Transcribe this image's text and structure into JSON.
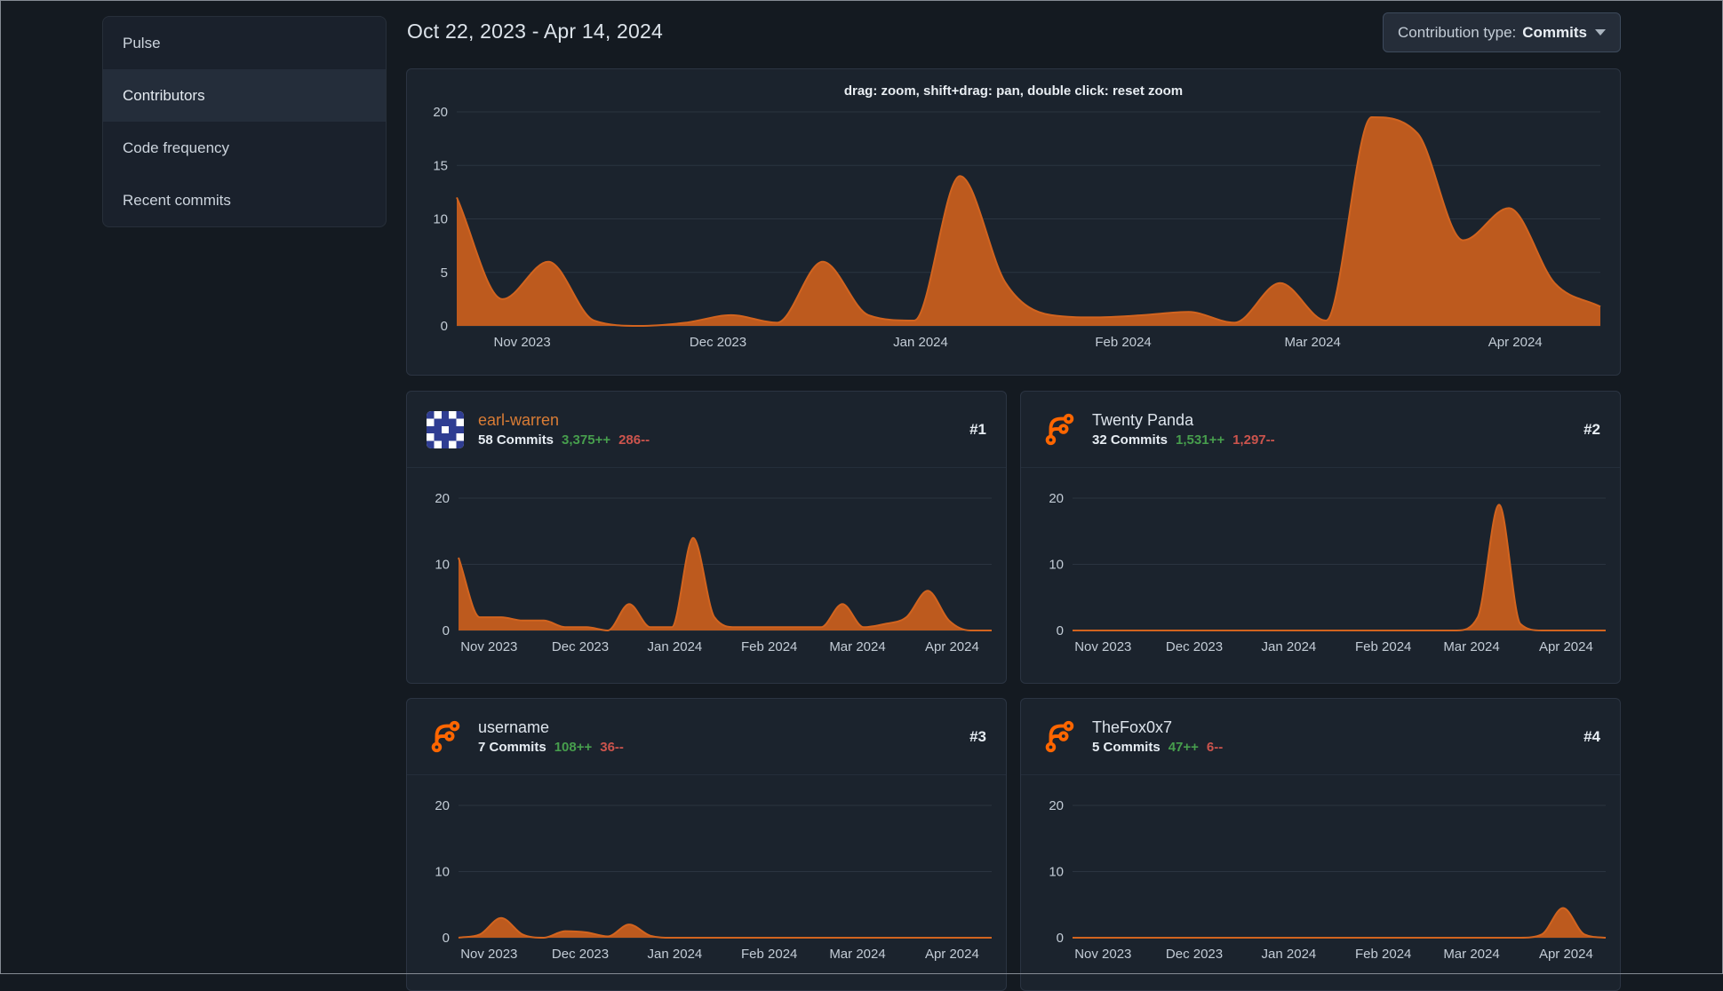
{
  "theme": {
    "page_bg": "#141a21",
    "card_bg": "#1b232d",
    "card_border": "#2b3442",
    "grid_color": "#2b3440",
    "tick_color": "#c3ccd6",
    "chart_fill": "#bd5a1e",
    "chart_stroke": "#d2641f",
    "additions_green": "#479e4d",
    "deletions_red": "#cc544d",
    "link_orange": "#d97c35",
    "forgejo_logo_orange": "#ff6600",
    "identicon_blue": "#2f3d92"
  },
  "sidebar": {
    "items": [
      {
        "label": "Pulse",
        "active": false
      },
      {
        "label": "Contributors",
        "active": true
      },
      {
        "label": "Code frequency",
        "active": false
      },
      {
        "label": "Recent commits",
        "active": false
      }
    ]
  },
  "header": {
    "date_range": "Oct 22, 2023 - Apr 14, 2024",
    "contribution_type_label": "Contribution type:",
    "contribution_type_value": "Commits"
  },
  "main_chart_hint": "drag: zoom, shift+drag: pan, double click: reset zoom",
  "contributors": [
    {
      "rank": "#1",
      "name": "earl-warren",
      "name_style": "orange",
      "avatar": "identicon-blue",
      "commits_label": "58 Commits",
      "additions": "3,375++",
      "deletions": "286--"
    },
    {
      "rank": "#2",
      "name": "Twenty Panda",
      "name_style": "plain",
      "avatar": "forgejo-logo",
      "commits_label": "32 Commits",
      "additions": "1,531++",
      "deletions": "1,297--"
    },
    {
      "rank": "#3",
      "name": "username",
      "name_style": "plain",
      "avatar": "forgejo-logo",
      "commits_label": "7 Commits",
      "additions": "108++",
      "deletions": "36--"
    },
    {
      "rank": "#4",
      "name": "TheFox0x7",
      "name_style": "plain",
      "avatar": "forgejo-logo",
      "commits_label": "5 Commits",
      "additions": "47++",
      "deletions": "6--"
    }
  ],
  "chart_data": [
    {
      "name": "overall-contributions",
      "type": "area",
      "title": "drag: zoom, shift+drag: pan, double click: reset zoom",
      "x_unit": "week",
      "x_range": [
        "Oct 22, 2023",
        "Apr 14, 2024"
      ],
      "weeks": 25,
      "x_ticks": [
        {
          "label": "Nov 2023",
          "week": 1.43
        },
        {
          "label": "Dec 2023",
          "week": 5.71
        },
        {
          "label": "Jan 2024",
          "week": 10.14
        },
        {
          "label": "Feb 2024",
          "week": 14.57
        },
        {
          "label": "Mar 2024",
          "week": 18.71
        },
        {
          "label": "Apr 2024",
          "week": 23.14
        }
      ],
      "y_ticks": [
        0,
        5,
        10,
        15,
        20
      ],
      "y_max": 20,
      "ylim": [
        0,
        20
      ],
      "grid": true,
      "legend": "none",
      "values": [
        12,
        2.5,
        6,
        0.5,
        0,
        0.3,
        1,
        0.3,
        6,
        1,
        0.5,
        14,
        4,
        1,
        0.8,
        1,
        1.3,
        0.3,
        4,
        0.5,
        19.5,
        18,
        8,
        11,
        4,
        1.8
      ]
    },
    {
      "name": "earl-warren-commits",
      "type": "area",
      "weeks": 25,
      "x_ticks": [
        {
          "label": "Nov 2023",
          "week": 1.43
        },
        {
          "label": "Dec 2023",
          "week": 5.71
        },
        {
          "label": "Jan 2024",
          "week": 10.14
        },
        {
          "label": "Feb 2024",
          "week": 14.57
        },
        {
          "label": "Mar 2024",
          "week": 18.71
        },
        {
          "label": "Apr 2024",
          "week": 23.14
        }
      ],
      "y_ticks": [
        0,
        10,
        20
      ],
      "y_max": 20,
      "ylim": [
        0,
        20
      ],
      "grid": true,
      "values": [
        11,
        2,
        2,
        1.5,
        1.5,
        0.5,
        0.5,
        0,
        4,
        0.5,
        0.5,
        14,
        2,
        0.5,
        0.5,
        0.5,
        0.5,
        0.5,
        4,
        0.5,
        1,
        2,
        6,
        1.5,
        0,
        0
      ]
    },
    {
      "name": "twenty-panda-commits",
      "type": "area",
      "weeks": 25,
      "x_ticks": [
        {
          "label": "Nov 2023",
          "week": 1.43
        },
        {
          "label": "Dec 2023",
          "week": 5.71
        },
        {
          "label": "Jan 2024",
          "week": 10.14
        },
        {
          "label": "Feb 2024",
          "week": 14.57
        },
        {
          "label": "Mar 2024",
          "week": 18.71
        },
        {
          "label": "Apr 2024",
          "week": 23.14
        }
      ],
      "y_ticks": [
        0,
        10,
        20
      ],
      "y_max": 20,
      "ylim": [
        0,
        20
      ],
      "grid": true,
      "values": [
        0,
        0,
        0,
        0,
        0,
        0,
        0,
        0,
        0,
        0,
        0,
        0,
        0,
        0,
        0,
        0,
        0,
        0,
        0,
        2,
        19,
        1,
        0,
        0,
        0,
        0
      ]
    },
    {
      "name": "username-commits",
      "type": "area",
      "weeks": 25,
      "x_ticks": [
        {
          "label": "Nov 2023",
          "week": 1.43
        },
        {
          "label": "Dec 2023",
          "week": 5.71
        },
        {
          "label": "Jan 2024",
          "week": 10.14
        },
        {
          "label": "Feb 2024",
          "week": 14.57
        },
        {
          "label": "Mar 2024",
          "week": 18.71
        },
        {
          "label": "Apr 2024",
          "week": 23.14
        }
      ],
      "y_ticks": [
        0,
        10,
        20
      ],
      "y_max": 20,
      "ylim": [
        0,
        20
      ],
      "grid": true,
      "values": [
        0,
        0.5,
        3,
        0.5,
        0,
        1,
        0.8,
        0.2,
        2,
        0.3,
        0,
        0,
        0,
        0,
        0,
        0,
        0,
        0,
        0,
        0,
        0,
        0,
        0,
        0,
        0,
        0
      ]
    },
    {
      "name": "thefox0x7-commits",
      "type": "area",
      "weeks": 25,
      "x_ticks": [
        {
          "label": "Nov 2023",
          "week": 1.43
        },
        {
          "label": "Dec 2023",
          "week": 5.71
        },
        {
          "label": "Jan 2024",
          "week": 10.14
        },
        {
          "label": "Feb 2024",
          "week": 14.57
        },
        {
          "label": "Mar 2024",
          "week": 18.71
        },
        {
          "label": "Apr 2024",
          "week": 23.14
        }
      ],
      "y_ticks": [
        0,
        10,
        20
      ],
      "y_max": 20,
      "ylim": [
        0,
        20
      ],
      "grid": true,
      "values": [
        0,
        0,
        0,
        0,
        0,
        0,
        0,
        0,
        0,
        0,
        0,
        0,
        0,
        0,
        0,
        0,
        0,
        0,
        0,
        0,
        0,
        0,
        0.5,
        4.5,
        0.5,
        0
      ]
    }
  ]
}
